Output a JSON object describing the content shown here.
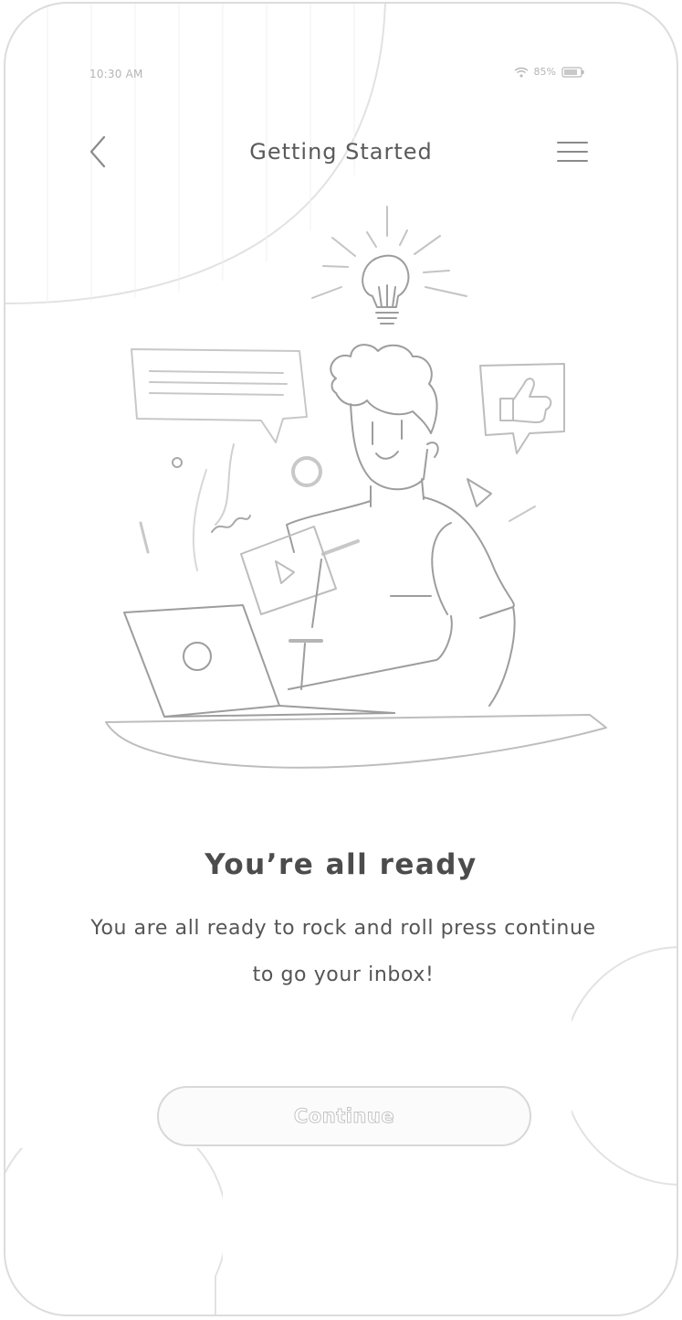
{
  "status_bar": {
    "time": "10:30 AM",
    "battery_percent": "85%",
    "wifi_icon": "wifi-icon",
    "battery_icon": "battery-icon"
  },
  "nav": {
    "title": "Getting Started",
    "back_icon": "chevron-left-icon",
    "menu_icon": "hamburger-menu-icon"
  },
  "illustration": {
    "icon": "person-at-laptop-illustration"
  },
  "content": {
    "heading": "You’re all ready",
    "body": "You are all ready to rock and roll press continue to go your inbox!"
  },
  "actions": {
    "continue_label": "Continue"
  },
  "colors": {
    "background": "#ffffff",
    "line": "#d8d8d8",
    "text": "#4c4c4c"
  }
}
